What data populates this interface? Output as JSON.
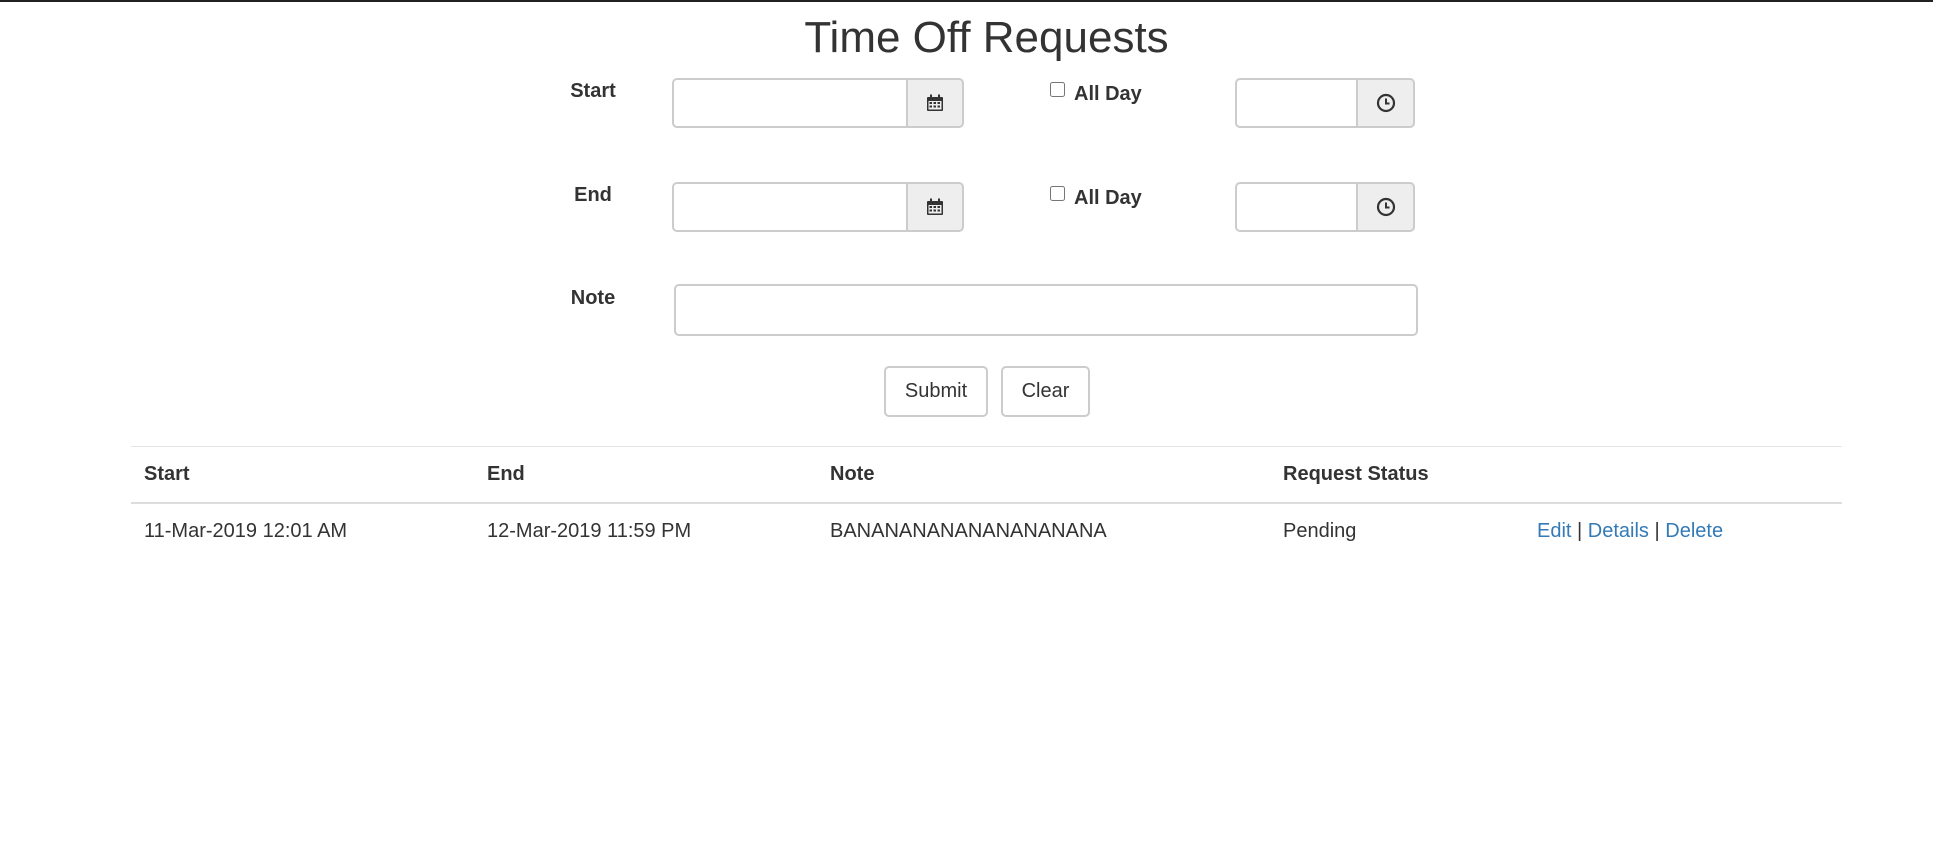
{
  "page": {
    "title": "Time Off Requests"
  },
  "form": {
    "start_label": "Start",
    "end_label": "End",
    "note_label": "Note",
    "start_date_value": "",
    "start_time_value": "",
    "end_date_value": "",
    "end_time_value": "",
    "note_value": "",
    "all_day_label": "All Day",
    "start_all_day_checked": false,
    "end_all_day_checked": false,
    "submit_label": "Submit",
    "clear_label": "Clear",
    "icons": {
      "date": "calendar-icon",
      "time": "clock-icon"
    }
  },
  "table": {
    "headers": {
      "start": "Start",
      "end": "End",
      "note": "Note",
      "status": "Request Status"
    },
    "rows": [
      {
        "start": "11-Mar-2019 12:01 AM",
        "end": "12-Mar-2019 11:59 PM",
        "note": "BANANANANANANANANANA",
        "status": "Pending",
        "edit_label": "Edit",
        "details_label": "Details",
        "delete_label": "Delete",
        "separator": "|"
      }
    ]
  },
  "colors": {
    "link": "#337ab7",
    "text": "#333333",
    "addon_bg": "#eeeeee",
    "border": "#cccccc"
  }
}
